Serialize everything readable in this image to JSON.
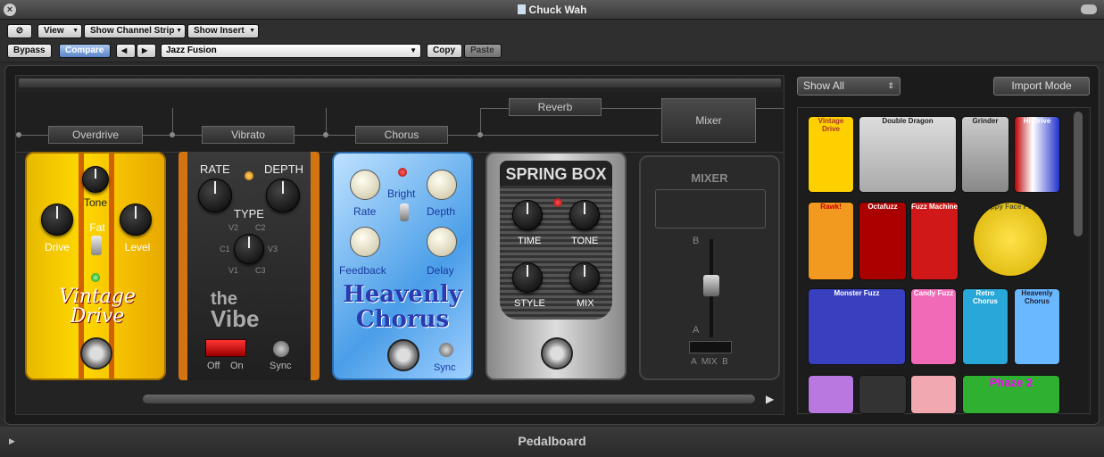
{
  "window": {
    "title": "Chuck Wah",
    "close_icon": "close-icon"
  },
  "toolbar": {
    "link_label": "⊘",
    "view_label": "View",
    "show_channel_strip_label": "Show Channel Strip",
    "show_insert_label": "Show Insert",
    "bypass_label": "Bypass",
    "compare_label": "Compare",
    "prev_label": "◀",
    "next_label": "▶",
    "preset_value": "Jazz Fusion",
    "copy_label": "Copy",
    "paste_label": "Paste"
  },
  "routing": {
    "slots": [
      "Overdrive",
      "Vibrato",
      "Chorus",
      "Reverb",
      "Mixer"
    ]
  },
  "pedals": {
    "vintage_drive": {
      "tone": "Tone",
      "drive": "Drive",
      "fat": "Fat",
      "level": "Level",
      "name1": "Vintage",
      "name2": "Drive"
    },
    "vibe": {
      "rate": "RATE",
      "depth": "DEPTH",
      "type": "TYPE",
      "v2": "V2",
      "c2": "C2",
      "c1": "C1",
      "v3": "V3",
      "v1": "V1",
      "c3": "C3",
      "name1": "the",
      "name2": "Vibe",
      "off": "Off",
      "on": "On",
      "sync": "Sync"
    },
    "chorus": {
      "bright": "Bright",
      "rate": "Rate",
      "depth": "Depth",
      "feedback": "Feedback",
      "delay": "Delay",
      "name1": "Heavenly",
      "name2": "Chorus",
      "sync": "Sync"
    },
    "spring": {
      "name": "SPRING BOX",
      "time": "TIME",
      "tone": "TONE",
      "style": "STYLE",
      "mix": "MIX"
    },
    "mixer": {
      "title": "MIXER",
      "b": "B",
      "a": "A",
      "bottom": "A  MIX  B"
    }
  },
  "browser": {
    "show_all": "Show All",
    "import_mode": "Import Mode",
    "items": [
      "Vintage Drive",
      "Double Dragon",
      "Grinder",
      "Hi-Drive",
      "Rawk!",
      "Octafuzz",
      "Fuzz Machine",
      "Happy Face Fuzz",
      "Monster Fuzz",
      "Candy Fuzz",
      "Retro Chorus",
      "Heavenly Chorus",
      "",
      "",
      "",
      "Phaze 2"
    ]
  },
  "footer": {
    "title": "Pedalboard",
    "disclosure": "▶"
  }
}
